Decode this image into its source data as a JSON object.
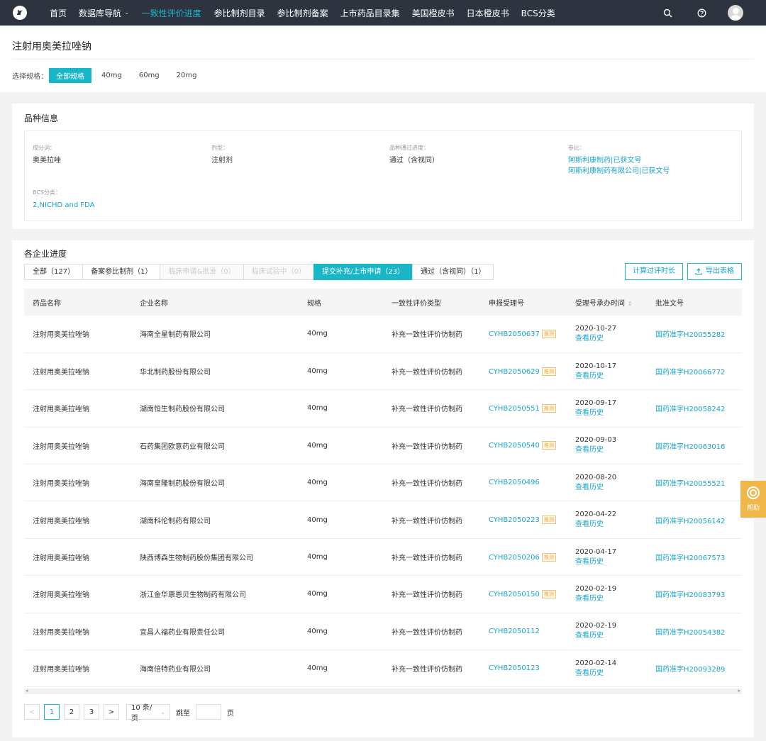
{
  "nav": {
    "items": [
      {
        "label": "首页",
        "active": false,
        "caret": false
      },
      {
        "label": "数据库导航",
        "active": false,
        "caret": true
      },
      {
        "label": "一致性评价进度",
        "active": true,
        "caret": false
      },
      {
        "label": "参比制剂目录",
        "active": false,
        "caret": false
      },
      {
        "label": "参比制剂备案",
        "active": false,
        "caret": false
      },
      {
        "label": "上市药品目录集",
        "active": false,
        "caret": false
      },
      {
        "label": "美国橙皮书",
        "active": false,
        "caret": false
      },
      {
        "label": "日本橙皮书",
        "active": false,
        "caret": false
      },
      {
        "label": "BCS分类",
        "active": false,
        "caret": false
      }
    ],
    "caret_glyph": "⌄"
  },
  "header": {
    "title": "注射用奥美拉唑钠",
    "spec_label": "选择规格：",
    "specs": [
      "全部规格",
      "40mg",
      "60mg",
      "20mg"
    ]
  },
  "info": {
    "title": "品种信息",
    "ingredient_label": "成分词：",
    "ingredient": "奥美拉唑",
    "form_label": "剂型：",
    "form": "注射剂",
    "status_label": "品种通过进度：",
    "status": "通过（含视同）",
    "reference_label": "参比：",
    "reference_1": "阿斯利康制药|已获文号",
    "reference_2": "阿斯利康制药有限公司|已获文号",
    "bcs_label": "BCS分类：",
    "bcs": "2,NICHD and FDA"
  },
  "progress": {
    "title": "各企业进度",
    "tabs": [
      {
        "label": "全部（127）",
        "state": "normal"
      },
      {
        "label": "备案参比制剂（1）",
        "state": "normal"
      },
      {
        "label": "临床申请&批准（0）",
        "state": "disabled"
      },
      {
        "label": "临床试验中（0）",
        "state": "disabled"
      },
      {
        "label": "提交补充/上市申请（23）",
        "state": "active"
      },
      {
        "label": "通过（含视同）（1）",
        "state": "normal"
      }
    ],
    "calc_button": "计算过评时长",
    "export_button": "导出表格",
    "columns": [
      "药品名称",
      "企业名称",
      "规格",
      "一致性评价类型",
      "申报受理号",
      "受理号承办时间",
      "批准文号"
    ],
    "sort_glyph": "⇕",
    "tag_label": "推测",
    "history_label": "查看历史",
    "rows": [
      {
        "drug": "注射用奥美拉唑钠",
        "company": "海南全星制药有限公司",
        "spec": "40mg",
        "type": "补充一致性评价仿制药",
        "acceptance": "CYHB2050637",
        "tag": true,
        "date": "2020-10-27",
        "approval": "国药准字H20055282"
      },
      {
        "drug": "注射用奥美拉唑钠",
        "company": "华北制药股份有限公司",
        "spec": "40mg",
        "type": "补充一致性评价仿制药",
        "acceptance": "CYHB2050629",
        "tag": true,
        "date": "2020-10-17",
        "approval": "国药准字H20066772"
      },
      {
        "drug": "注射用奥美拉唑钠",
        "company": "湖南恒生制药股份有限公司",
        "spec": "40mg",
        "type": "补充一致性评价仿制药",
        "acceptance": "CYHB2050551",
        "tag": true,
        "date": "2020-09-17",
        "approval": "国药准字H20058242"
      },
      {
        "drug": "注射用奥美拉唑钠",
        "company": "石药集团欧意药业有限公司",
        "spec": "40mg",
        "type": "补充一致性评价仿制药",
        "acceptance": "CYHB2050540",
        "tag": true,
        "date": "2020-09-03",
        "approval": "国药准字H20063016"
      },
      {
        "drug": "注射用奥美拉唑钠",
        "company": "海南皇隆制药股份有限公司",
        "spec": "40mg",
        "type": "补充一致性评价仿制药",
        "acceptance": "CYHB2050496",
        "tag": false,
        "date": "2020-08-20",
        "approval": "国药准字H20055521"
      },
      {
        "drug": "注射用奥美拉唑钠",
        "company": "湖南科伦制药有限公司",
        "spec": "40mg",
        "type": "补充一致性评价仿制药",
        "acceptance": "CYHB2050223",
        "tag": true,
        "date": "2020-04-22",
        "approval": "国药准字H20056142"
      },
      {
        "drug": "注射用奥美拉唑钠",
        "company": "陕西博森生物制药股份集团有限公司",
        "spec": "40mg",
        "type": "补充一致性评价仿制药",
        "acceptance": "CYHB2050206",
        "tag": true,
        "date": "2020-04-17",
        "approval": "国药准字H20067573"
      },
      {
        "drug": "注射用奥美拉唑钠",
        "company": "浙江金华康恩贝生物制药有限公司",
        "spec": "40mg",
        "type": "补充一致性评价仿制药",
        "acceptance": "CYHB2050150",
        "tag": true,
        "date": "2020-02-19",
        "approval": "国药准字H20083793"
      },
      {
        "drug": "注射用奥美拉唑钠",
        "company": "宜昌人福药业有限责任公司",
        "spec": "40mg",
        "type": "补充一致性评价仿制药",
        "acceptance": "CYHB2050112",
        "tag": false,
        "date": "2020-02-19",
        "approval": "国药准字H20054382"
      },
      {
        "drug": "注射用奥美拉唑钠",
        "company": "海南倍特药业有限公司",
        "spec": "40mg",
        "type": "补充一致性评价仿制药",
        "acceptance": "CYHB2050123",
        "tag": false,
        "date": "2020-02-14",
        "approval": "国药准字H20093289"
      }
    ]
  },
  "pager": {
    "prev": "<",
    "next": ">",
    "pages": [
      "1",
      "2",
      "3"
    ],
    "current": "1",
    "page_size": "10 条/页",
    "goto_label": "跳至",
    "page_unit": "页"
  },
  "help": {
    "label": "帮助"
  },
  "colors": {
    "accent": "#19b6c8",
    "link": "#19a3c8",
    "nav_bg": "#2e3340",
    "tag": "#f0a83c"
  }
}
